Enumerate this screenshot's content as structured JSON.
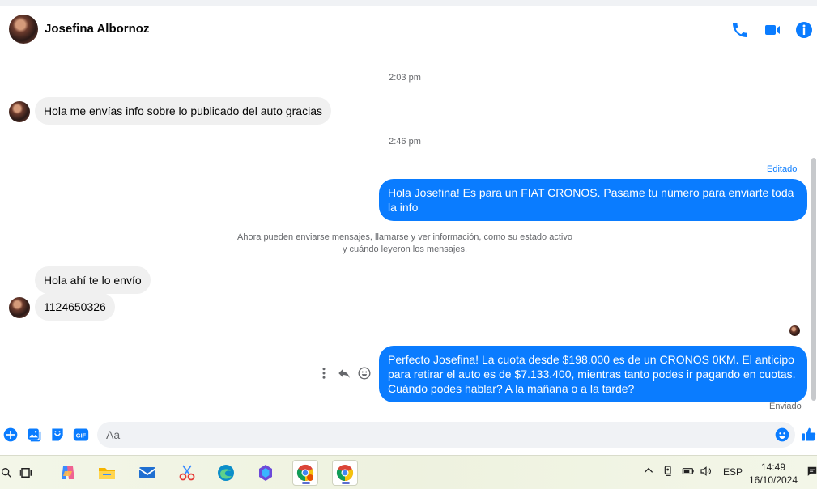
{
  "header": {
    "contact_name": "Josefina Albornoz",
    "icons": [
      "phone-icon",
      "video-camera-icon",
      "info-icon"
    ]
  },
  "messages": {
    "time1": "2:03 pm",
    "in1": "Hola me envías info sobre lo publicado del auto gracias",
    "time2": "2:46 pm",
    "edited_label": "Editado",
    "out1": "Hola Josefina!  Es para un FIAT CRONOS. Pasame tu número para enviarte toda la info",
    "system_line1": "Ahora pueden enviarse mensajes, llamarse y ver información, como su estado activo",
    "system_line2": "y cuándo leyeron los mensajes.",
    "in2": "Hola ahí te lo envío",
    "in3": "1124650326",
    "out2": "Perfecto Josefina! La cuota desde $198.000 es de un CRONOS 0KM. El anticipo para retirar el auto es de $7.133.400, mientras tanto podes ir pagando en cuotas. Cuándo podes hablar? A la mañana o a la tarde?",
    "sent_label": "Enviado"
  },
  "composer": {
    "placeholder": "Aa",
    "gif_label": "GIF"
  },
  "taskbar": {
    "language": "ESP",
    "time": "14:49",
    "date": "16/10/2024"
  },
  "colors": {
    "accent": "#0a7cff",
    "incoming_bubble": "#f0f0f0",
    "muted_text": "#65676b"
  }
}
